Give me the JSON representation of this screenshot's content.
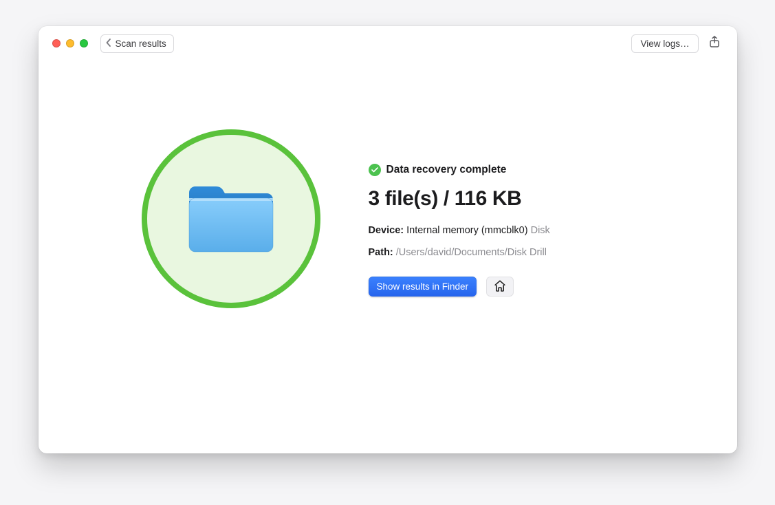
{
  "toolbar": {
    "back_label": "Scan results",
    "view_logs_label": "View logs…"
  },
  "status": {
    "message": "Data recovery complete"
  },
  "summary": {
    "file_count": 3,
    "size_value": 116,
    "size_unit": "KB",
    "headline": "3 file(s) / 116 KB"
  },
  "device": {
    "label": "Device:",
    "name": "Internal memory (mmcblk0)",
    "type_tag": "Disk"
  },
  "path": {
    "label": "Path:",
    "value": "/Users/david/Documents/Disk Drill"
  },
  "actions": {
    "show_in_finder": "Show results in Finder"
  }
}
